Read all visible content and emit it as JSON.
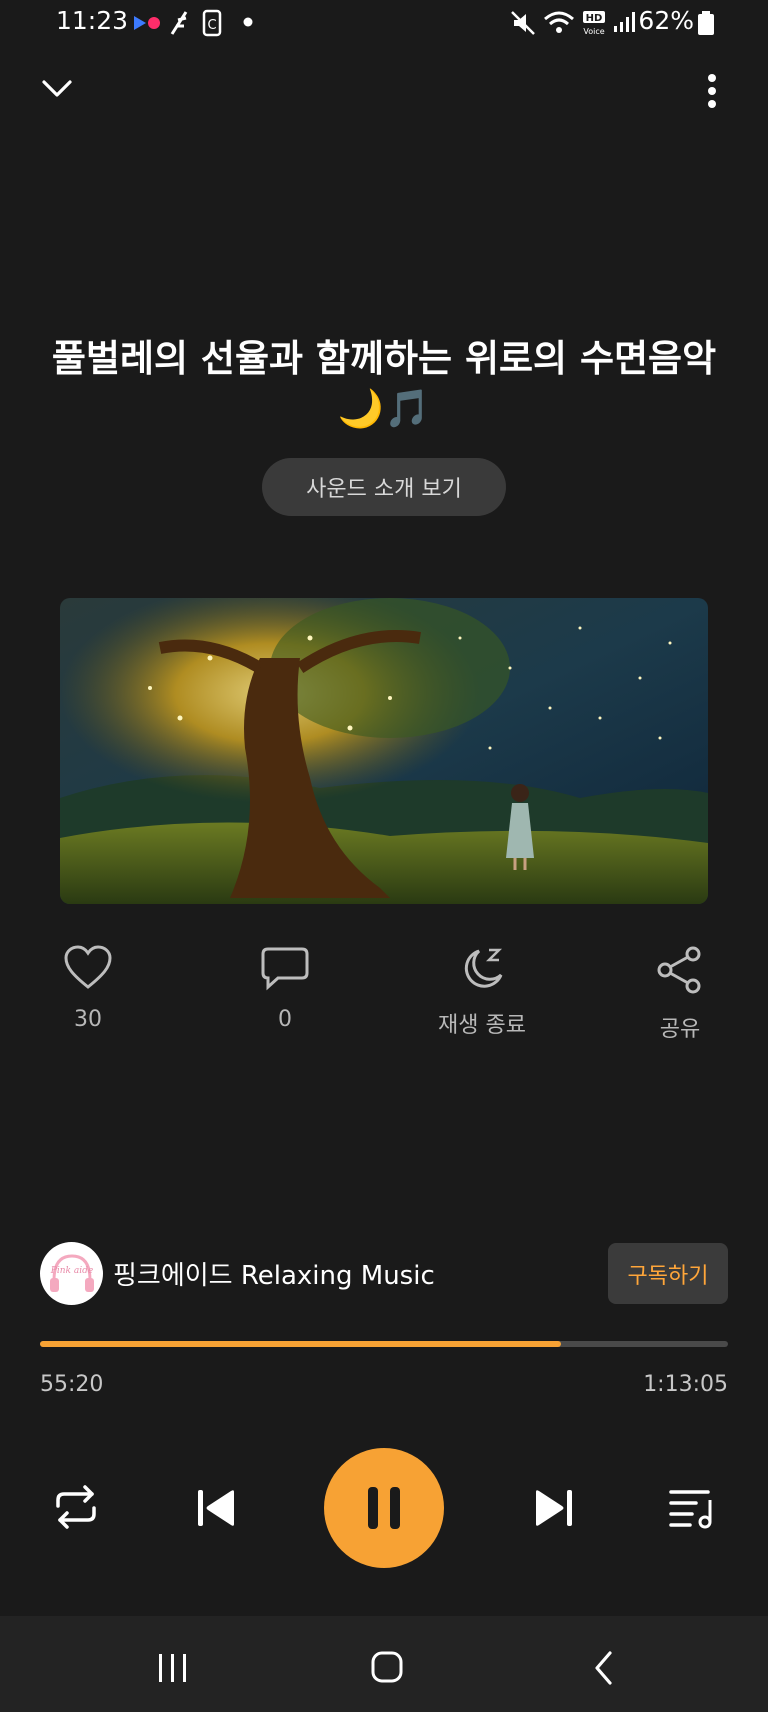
{
  "status_bar": {
    "time": "11:23",
    "battery": "62%",
    "icons": [
      "app-notification-icon",
      "feather-icon",
      "c-icon",
      "dot-icon",
      "mute-icon",
      "wifi-icon",
      "hd-voice-icon",
      "signal-icon",
      "battery-icon"
    ]
  },
  "header": {
    "collapse_icon": "chevron-down-icon",
    "more_icon": "more-vertical-icon"
  },
  "track": {
    "title": "풀벌레의 선율과 함께하는 위로의 수면음악 🌙🎵",
    "intro_button": "사운드 소개 보기"
  },
  "actions": {
    "like_count": "30",
    "comment_count": "0",
    "sleep_timer_label": "재생 종료",
    "share_label": "공유"
  },
  "channel": {
    "name": "핑크에이드 Relaxing Music",
    "avatar_text": "Pink aide",
    "subscribe_label": "구독하기"
  },
  "playback": {
    "current_time": "55:20",
    "total_time": "1:13:05",
    "progress": 0.757,
    "state": "playing"
  },
  "colors": {
    "accent": "#f7a234",
    "background": "#1a1a1a"
  }
}
